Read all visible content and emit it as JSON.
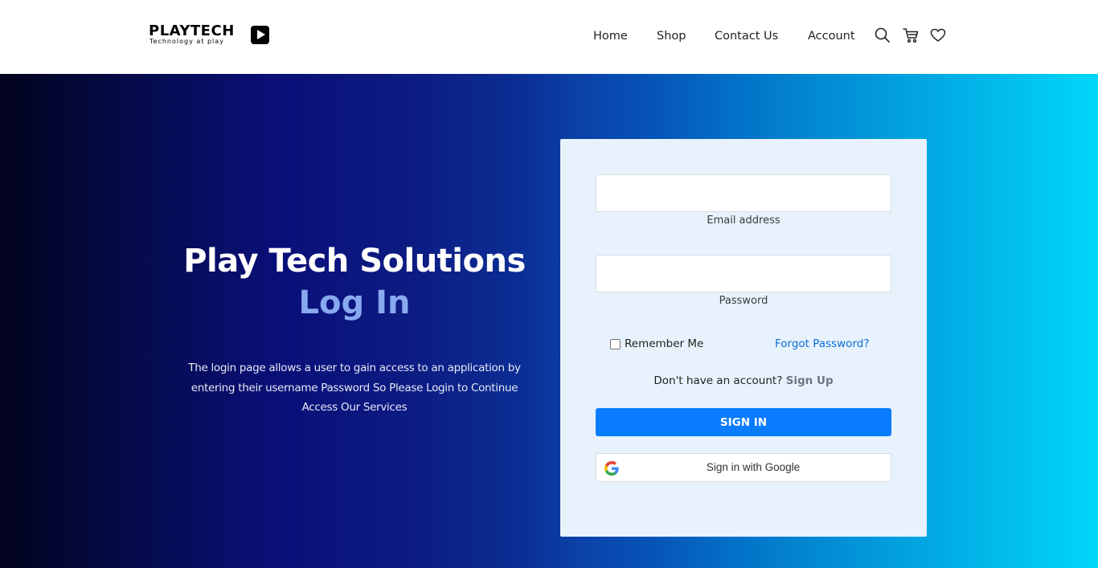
{
  "brand": {
    "name": "PLAYTECH",
    "tagline": "Technology at play"
  },
  "nav": {
    "items": [
      {
        "label": "Home"
      },
      {
        "label": "Shop"
      },
      {
        "label": "Contact Us"
      },
      {
        "label": "Account"
      }
    ],
    "icons": [
      "search-icon",
      "cart-icon",
      "heart-icon"
    ]
  },
  "hero": {
    "title": "Play Tech Solutions",
    "subtitle": "Log In",
    "description": "The login page allows a user to gain access to an application by entering their username Password So Please Login to Continue Access Our Services"
  },
  "login_form": {
    "email": {
      "label": "Email address",
      "value": ""
    },
    "password": {
      "label": "Password",
      "value": ""
    },
    "remember_label": "Remember Me",
    "remember_checked": false,
    "forgot_label": "Forgot Password?",
    "signup_prompt": "Don't have an account?",
    "signup_link": "Sign Up",
    "signin_label": "SIGN IN",
    "google_label": "Sign in with Google"
  },
  "colors": {
    "primary_button": "#0a7cff",
    "link": "#0a6fd8",
    "subtitle": "#88a9ee",
    "card_background": "#e8f2fd"
  }
}
